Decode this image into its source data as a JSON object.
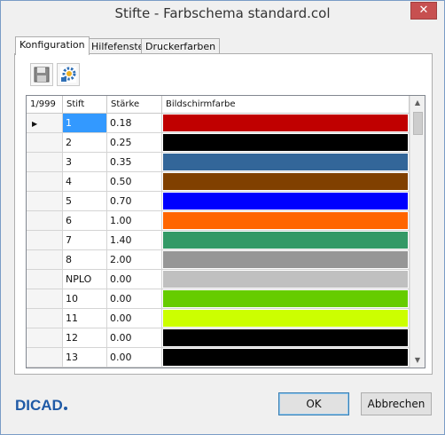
{
  "window": {
    "title": "Stifte - Farbschema standard.col",
    "close_glyph": "✕"
  },
  "tabs": [
    {
      "label": "Konfiguration",
      "active": true
    },
    {
      "label": "Hilfefenster",
      "active": false
    },
    {
      "label": "Druckerfarben",
      "active": false
    }
  ],
  "toolbar": {
    "save_icon": "floppy-disk-icon",
    "settings_icon": "gear-icon"
  },
  "grid": {
    "corner_label": "1/999",
    "columns": [
      "Stift",
      "Stärke",
      "Bildschirmfarbe"
    ],
    "selected_row": 0,
    "current_row_marker": "▶",
    "rows": [
      {
        "stift": "1",
        "staerke": "0.18",
        "color": "#c00000"
      },
      {
        "stift": "2",
        "staerke": "0.25",
        "color": "#000000"
      },
      {
        "stift": "3",
        "staerke": "0.35",
        "color": "#336699"
      },
      {
        "stift": "4",
        "staerke": "0.50",
        "color": "#804000"
      },
      {
        "stift": "5",
        "staerke": "0.70",
        "color": "#0000ff"
      },
      {
        "stift": "6",
        "staerke": "1.00",
        "color": "#ff6600"
      },
      {
        "stift": "7",
        "staerke": "1.40",
        "color": "#339966"
      },
      {
        "stift": "8",
        "staerke": "2.00",
        "color": "#969696"
      },
      {
        "stift": "NPLO",
        "staerke": "0.00",
        "color": "#c0c0c0"
      },
      {
        "stift": "10",
        "staerke": "0.00",
        "color": "#66cc00"
      },
      {
        "stift": "11",
        "staerke": "0.00",
        "color": "#ccff00"
      },
      {
        "stift": "12",
        "staerke": "0.00",
        "color": "#000000"
      },
      {
        "stift": "13",
        "staerke": "0.00",
        "color": "#000000"
      }
    ]
  },
  "logo": {
    "text": "DICAD"
  },
  "buttons": {
    "ok_label": "OK",
    "cancel_label": "Abbrechen"
  }
}
